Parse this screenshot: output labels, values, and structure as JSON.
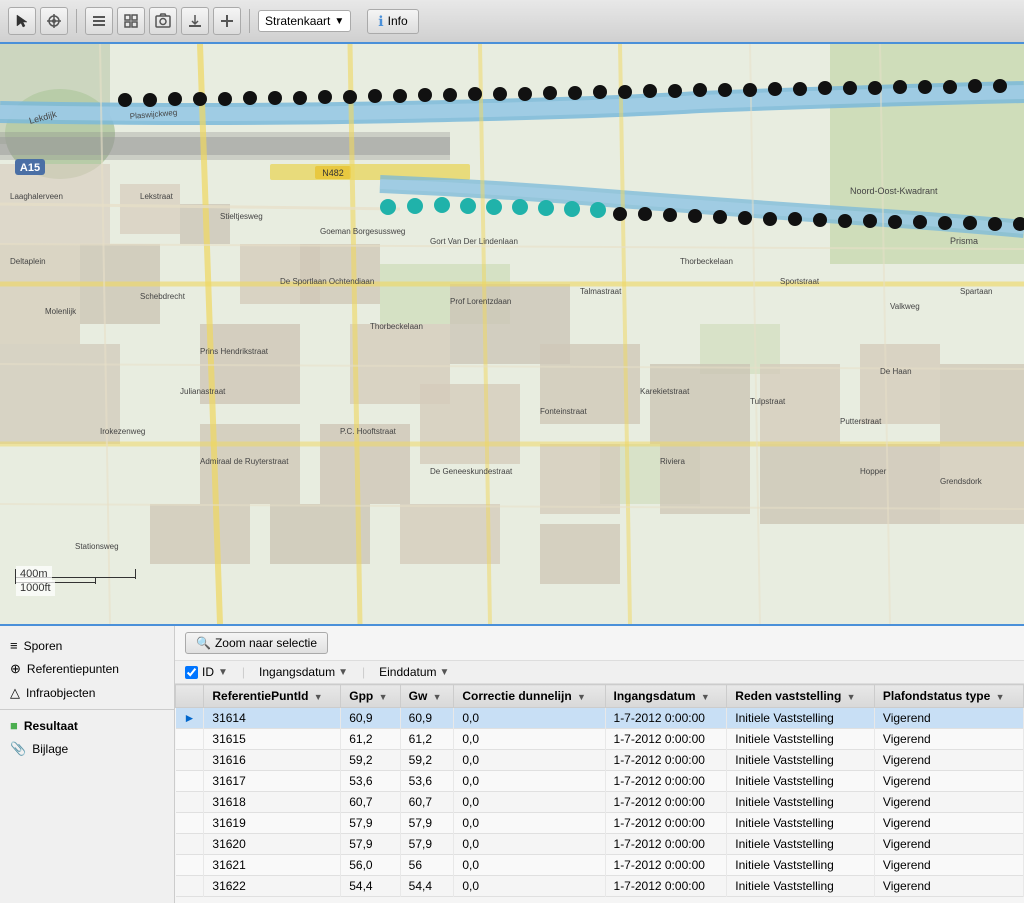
{
  "toolbar": {
    "map_selector_label": "Stratenkaart",
    "info_label": "Info",
    "chevron": "▼",
    "info_circle": "ℹ"
  },
  "sidebar": {
    "items": [
      {
        "id": "sporen",
        "label": "Sporen",
        "icon": "≡",
        "active": false
      },
      {
        "id": "referentiepunten",
        "label": "Referentiepunten",
        "icon": "⊕",
        "active": false
      },
      {
        "id": "infraobjecten",
        "label": "Infraobjecten",
        "icon": "△",
        "active": false
      },
      {
        "id": "resultaat",
        "label": "Resultaat",
        "icon": "■",
        "color": "#4CAF50",
        "active": true
      },
      {
        "id": "bijlage",
        "label": "Bijlage",
        "icon": "📎",
        "active": false
      }
    ]
  },
  "data_panel": {
    "zoom_btn_label": "Zoom naar selectie",
    "zoom_icon": "🔍",
    "top_filters": {
      "checkbox_checked": true,
      "id_label": "ID",
      "ingangsdatum_label": "Ingangsdatum",
      "einddatum_label": "Einddatum"
    },
    "table": {
      "columns": [
        {
          "key": "indicator",
          "label": ""
        },
        {
          "key": "referentiePuntId",
          "label": "ReferentiePuntId"
        },
        {
          "key": "gpp",
          "label": "Gpp"
        },
        {
          "key": "gw",
          "label": "Gw"
        },
        {
          "key": "correctie_dunnelijn",
          "label": "Correctie dunnelijn"
        },
        {
          "key": "ingangsdatum",
          "label": "Ingangsdatum"
        },
        {
          "key": "reden_vaststelling",
          "label": "Reden vaststelling"
        },
        {
          "key": "plafondstatus_type",
          "label": "Plafondstatus type"
        }
      ],
      "rows": [
        {
          "indicator": "►",
          "referentiePuntId": "31614",
          "gpp": "60,9",
          "gw": "60,9",
          "correctie_dunnelijn": "0,0",
          "ingangsdatum": "1-7-2012 0:00:00",
          "reden_vaststelling": "Initiele Vaststelling",
          "plafondstatus_type": "Vigerend",
          "selected": true
        },
        {
          "indicator": "",
          "referentiePuntId": "31615",
          "gpp": "61,2",
          "gw": "61,2",
          "correctie_dunnelijn": "0,0",
          "ingangsdatum": "1-7-2012 0:00:00",
          "reden_vaststelling": "Initiele Vaststelling",
          "plafondstatus_type": "Vigerend"
        },
        {
          "indicator": "",
          "referentiePuntId": "31616",
          "gpp": "59,2",
          "gw": "59,2",
          "correctie_dunnelijn": "0,0",
          "ingangsdatum": "1-7-2012 0:00:00",
          "reden_vaststelling": "Initiele Vaststelling",
          "plafondstatus_type": "Vigerend"
        },
        {
          "indicator": "",
          "referentiePuntId": "31617",
          "gpp": "53,6",
          "gw": "53,6",
          "correctie_dunnelijn": "0,0",
          "ingangsdatum": "1-7-2012 0:00:00",
          "reden_vaststelling": "Initiele Vaststelling",
          "plafondstatus_type": "Vigerend"
        },
        {
          "indicator": "",
          "referentiePuntId": "31618",
          "gpp": "60,7",
          "gw": "60,7",
          "correctie_dunnelijn": "0,0",
          "ingangsdatum": "1-7-2012 0:00:00",
          "reden_vaststelling": "Initiele Vaststelling",
          "plafondstatus_type": "Vigerend"
        },
        {
          "indicator": "",
          "referentiePuntId": "31619",
          "gpp": "57,9",
          "gw": "57,9",
          "correctie_dunnelijn": "0,0",
          "ingangsdatum": "1-7-2012 0:00:00",
          "reden_vaststelling": "Initiele Vaststelling",
          "plafondstatus_type": "Vigerend"
        },
        {
          "indicator": "",
          "referentiePuntId": "31620",
          "gpp": "57,9",
          "gw": "57,9",
          "correctie_dunnelijn": "0,0",
          "ingangsdatum": "1-7-2012 0:00:00",
          "reden_vaststelling": "Initiele Vaststelling",
          "plafondstatus_type": "Vigerend"
        },
        {
          "indicator": "",
          "referentiePuntId": "31621",
          "gpp": "56,0",
          "gw": "56",
          "correctie_dunnelijn": "0,0",
          "ingangsdatum": "1-7-2012 0:00:00",
          "reden_vaststelling": "Initiele Vaststelling",
          "plafondstatus_type": "Vigerend"
        },
        {
          "indicator": "",
          "referentiePuntId": "31622",
          "gpp": "54,4",
          "gw": "54,4",
          "correctie_dunnelijn": "0,0",
          "ingangsdatum": "1-7-2012 0:00:00",
          "reden_vaststelling": "Initiele Vaststelling",
          "plafondstatus_type": "Vigerend"
        }
      ]
    }
  },
  "map": {
    "scale_400m": "400m",
    "scale_1000ft": "1000ft"
  }
}
